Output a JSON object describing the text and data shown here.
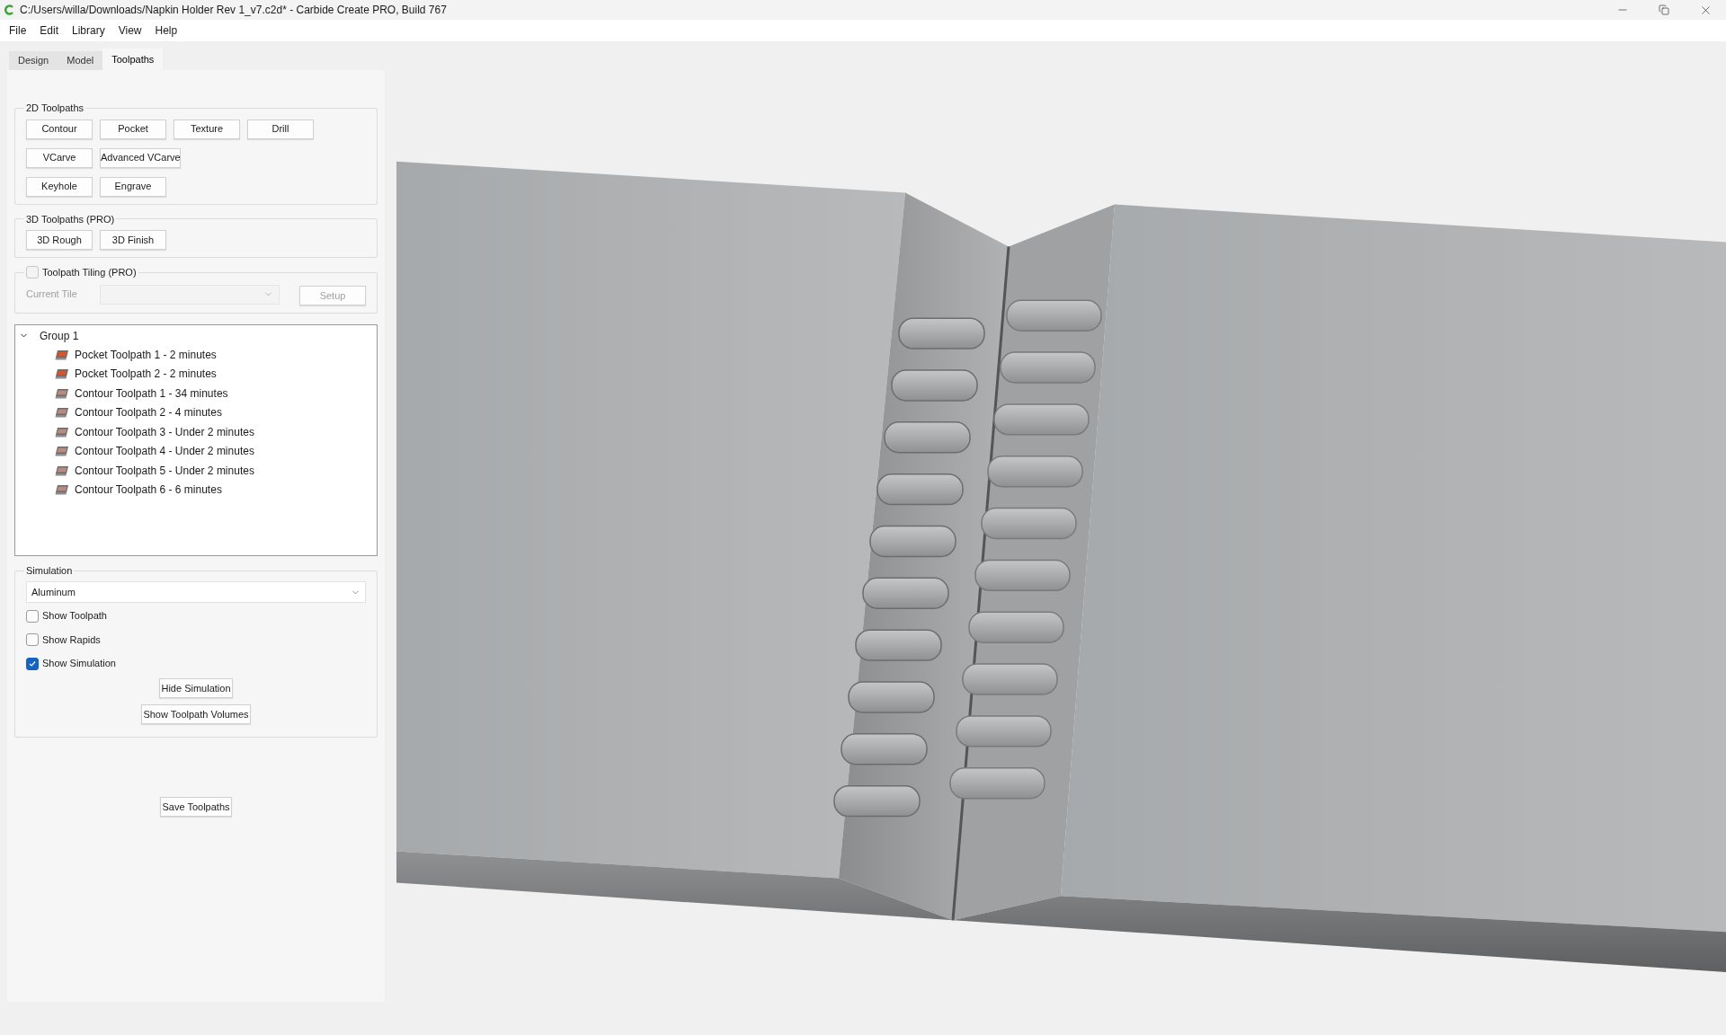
{
  "window": {
    "title": "C:/Users/willa/Downloads/Napkin Holder Rev 1_v7.c2d* - Carbide Create PRO, Build 767"
  },
  "menu": [
    "File",
    "Edit",
    "Library",
    "View",
    "Help"
  ],
  "tabs": [
    {
      "label": "Design",
      "selected": false
    },
    {
      "label": "Model",
      "selected": false
    },
    {
      "label": "Toolpaths",
      "selected": true
    }
  ],
  "toolpaths_2d": {
    "title": "2D Toolpaths",
    "rows": [
      [
        "Contour",
        "Pocket",
        "Texture",
        "Drill"
      ],
      [
        "VCarve",
        "Advanced VCarve"
      ],
      [
        "Keyhole",
        "Engrave"
      ]
    ]
  },
  "toolpaths_3d": {
    "title": "3D Toolpaths (PRO)",
    "buttons": [
      "3D Rough",
      "3D Finish"
    ]
  },
  "tiling": {
    "label": "Toolpath Tiling (PRO)",
    "checked": false,
    "disabled": true,
    "current_tile_label": "Current Tile",
    "setup_button": "Setup"
  },
  "tree": {
    "label": "Group 1",
    "expanded": true,
    "children": [
      {
        "label": "Pocket Toolpath 1 - 2 minutes",
        "kind": "pocket"
      },
      {
        "label": "Pocket Toolpath 2 - 2 minutes",
        "kind": "pocket"
      },
      {
        "label": "Contour Toolpath 1 - 34 minutes",
        "kind": "contour"
      },
      {
        "label": "Contour Toolpath 2 - 4 minutes",
        "kind": "contour"
      },
      {
        "label": "Contour Toolpath 3 - Under 2 minutes",
        "kind": "contour"
      },
      {
        "label": "Contour Toolpath 4 - Under 2 minutes",
        "kind": "contour"
      },
      {
        "label": "Contour Toolpath 5 - Under 2 minutes",
        "kind": "contour"
      },
      {
        "label": "Contour Toolpath 6 - 6 minutes",
        "kind": "contour"
      }
    ]
  },
  "simulation": {
    "title": "Simulation",
    "material": "Aluminum",
    "options": [
      {
        "label": "Show Toolpath",
        "checked": false
      },
      {
        "label": "Show Rapids",
        "checked": false
      },
      {
        "label": "Show Simulation",
        "checked": true
      }
    ],
    "buttons": [
      "Hide Simulation",
      "Show Toolpath Volumes"
    ]
  },
  "save_button": "Save Toolpaths"
}
